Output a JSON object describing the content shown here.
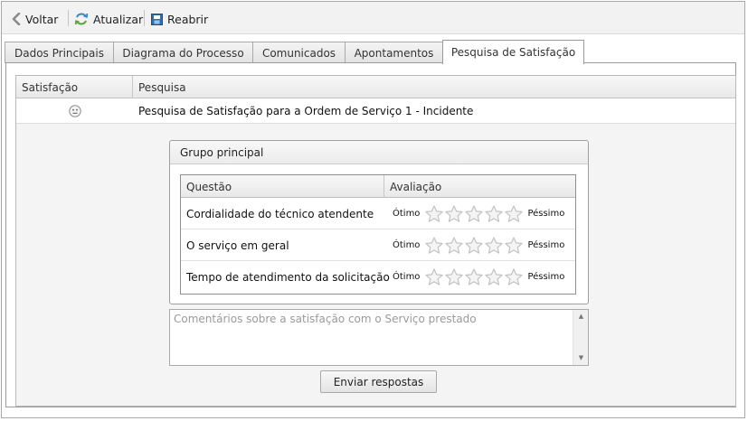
{
  "toolbar": {
    "back_label": "Voltar",
    "refresh_label": "Atualizar",
    "reopen_label": "Reabrir"
  },
  "tabs": [
    {
      "label": "Dados Principais",
      "active": false
    },
    {
      "label": "Diagrama do Processo",
      "active": false
    },
    {
      "label": "Comunicados",
      "active": false
    },
    {
      "label": "Apontamentos",
      "active": false
    },
    {
      "label": "Pesquisa de Satisfação",
      "active": true
    }
  ],
  "survey_grid": {
    "columns": [
      "Satisfação",
      "Pesquisa"
    ],
    "rows": [
      {
        "satisfaction_icon": "neutral-face-icon",
        "survey": "Pesquisa de Satisfação para a Ordem de Serviço 1 - Incidente"
      }
    ]
  },
  "group": {
    "title": "Grupo principal",
    "columns": [
      "Questão",
      "Avaliação"
    ],
    "best_label": "Ótimo",
    "worst_label": "Péssimo",
    "questions": [
      {
        "text": "Cordialidade do técnico atendente",
        "rating": 0,
        "max": 5
      },
      {
        "text": "O serviço em geral",
        "rating": 0,
        "max": 5
      },
      {
        "text": "Tempo de atendimento da solicitação",
        "rating": 0,
        "max": 5
      }
    ]
  },
  "comments": {
    "placeholder": "Comentários sobre a satisfação com o Serviço prestado",
    "value": ""
  },
  "submit_label": "Enviar respostas",
  "colors": {
    "refresh_icon": "#3a87c8",
    "reopen_icon": "#2d6fb4",
    "star_fill": "#f4f4f4",
    "star_stroke": "#c2c2c2"
  }
}
